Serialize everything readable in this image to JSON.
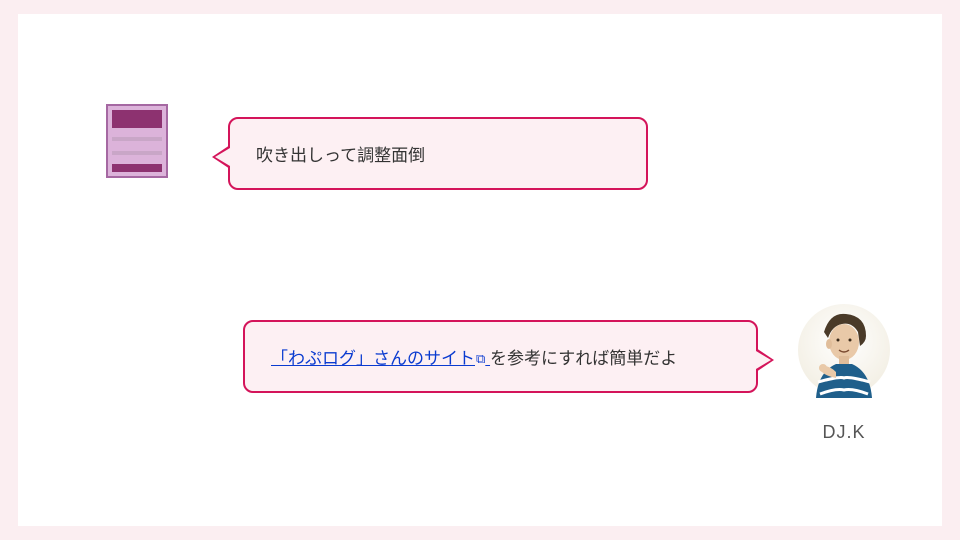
{
  "left": {
    "bubble_text": "吹き出しって調整面倒"
  },
  "right": {
    "link_text": "「わぷログ」さんのサイト",
    "suffix_text": "を参考にすれば簡単だよ",
    "author_name": "DJ.K"
  }
}
